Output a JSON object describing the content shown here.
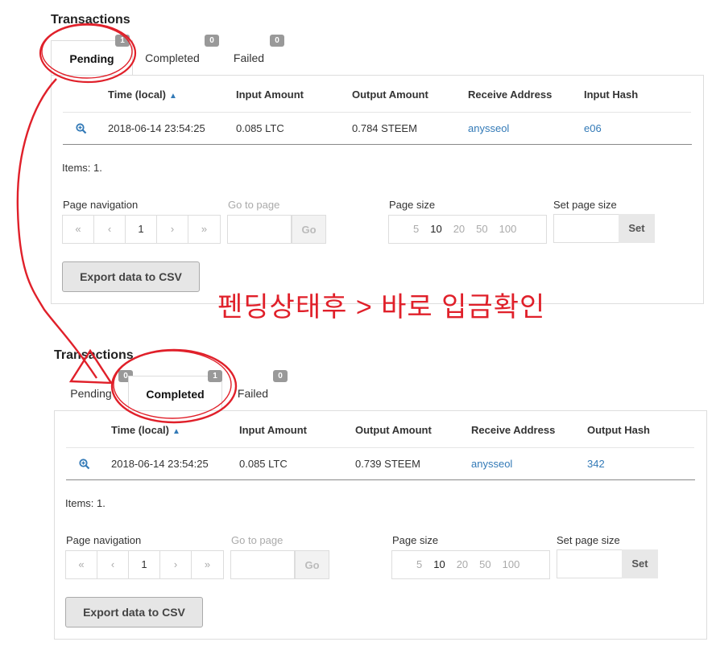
{
  "panel1": {
    "title": "Transactions",
    "tabs": [
      {
        "label": "Pending",
        "count": "1"
      },
      {
        "label": "Completed",
        "count": "0"
      },
      {
        "label": "Failed",
        "count": "0"
      }
    ],
    "columns": [
      "Time (local)",
      "Input Amount",
      "Output Amount",
      "Receive Address",
      "Input Hash"
    ],
    "row": {
      "time": "2018-06-14 23:54:25",
      "input": "0.085 LTC",
      "output": "0.784 STEEM",
      "address": "anysseol",
      "hash": "e06"
    },
    "items": "Items: 1.",
    "page_nav_label": "Page navigation",
    "goto_label": "Go to page",
    "go_button": "Go",
    "page_size_label": "Page size",
    "set_page_size_label": "Set page size",
    "set_button": "Set",
    "export_button": "Export data to CSV",
    "pager": [
      "«",
      "‹",
      "1",
      "›",
      "»"
    ],
    "sizes": [
      "5",
      "10",
      "20",
      "50",
      "100"
    ]
  },
  "panel2": {
    "title": "Transactions",
    "tabs": [
      {
        "label": "Pending",
        "count": "0"
      },
      {
        "label": "Completed",
        "count": "1"
      },
      {
        "label": "Failed",
        "count": "0"
      }
    ],
    "columns": [
      "Time (local)",
      "Input Amount",
      "Output Amount",
      "Receive Address",
      "Output Hash"
    ],
    "row": {
      "time": "2018-06-14 23:54:25",
      "input": "0.085 LTC",
      "output": "0.739 STEEM",
      "address": "anysseol",
      "hash": "342"
    },
    "items": "Items: 1.",
    "page_nav_label": "Page navigation",
    "goto_label": "Go to page",
    "go_button": "Go",
    "page_size_label": "Page size",
    "set_page_size_label": "Set page size",
    "set_button": "Set",
    "export_button": "Export data to CSV",
    "pager": [
      "«",
      "‹",
      "1",
      "›",
      "»"
    ],
    "sizes": [
      "5",
      "10",
      "20",
      "50",
      "100"
    ]
  },
  "annotation": {
    "text": "펜딩상태후 > 바로 입금확인",
    "color": "#e0202a"
  },
  "colors": {
    "link": "#337ab7",
    "badge": "#999999",
    "annotation": "#e0202a"
  }
}
